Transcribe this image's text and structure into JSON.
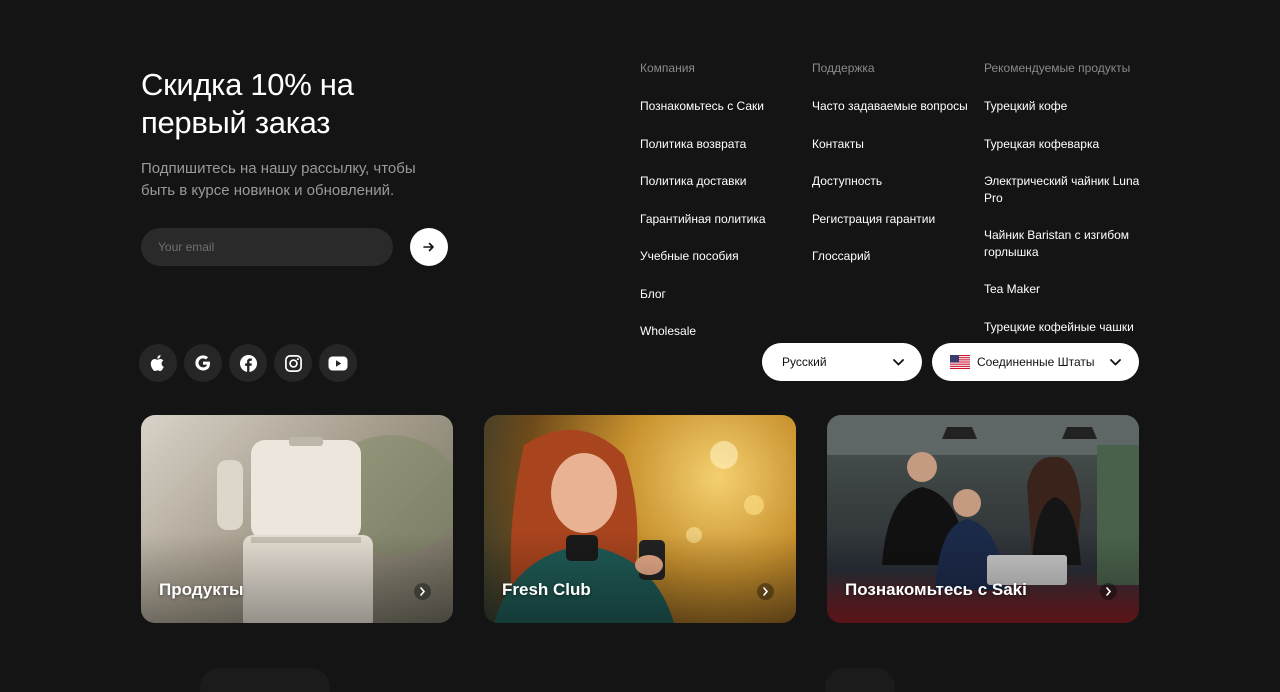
{
  "newsletter": {
    "title": "Скидка 10% на\nпервый заказ",
    "subtitle": "Подпишитесь на нашу рассылку, чтобы\nбыть в курсе новинок и обновлений.",
    "email_placeholder": "Your email",
    "submit_icon": "arrow-right-icon"
  },
  "social": [
    {
      "icon": "apple-icon"
    },
    {
      "icon": "google-icon"
    },
    {
      "icon": "facebook-icon"
    },
    {
      "icon": "instagram-icon"
    },
    {
      "icon": "youtube-icon"
    }
  ],
  "columns": [
    {
      "title": "Компания",
      "links": [
        "Познакомьтесь с Саки",
        "Политика возврата",
        "Политика доставки",
        "Гарантийная политика",
        "Учебные пособия",
        "Блог",
        "Wholesale"
      ]
    },
    {
      "title": "Поддержка",
      "links": [
        "Часто задаваемые вопросы",
        "Контакты",
        "Доступность",
        "Регистрация гарантии",
        "Глоссарий"
      ]
    },
    {
      "title": "Рекомендуемые продукты",
      "links": [
        "Турецкий кофе",
        "Турецкая кофеварка",
        "Электрический чайник Luna Pro",
        "Чайник Baristan с изгибом горлышка",
        "Tea Maker",
        "Турецкие кофейные чашки"
      ]
    }
  ],
  "selectors": {
    "language": "Русский",
    "country": "Соединенные Штаты",
    "country_flag": "us-flag-icon"
  },
  "cards": [
    {
      "label": "Продукты",
      "icon": "chevron-right-icon"
    },
    {
      "label": "Fresh Club",
      "icon": "chevron-right-icon"
    },
    {
      "label": "Познакомьтесь с Saki",
      "icon": "chevron-right-icon"
    }
  ],
  "colors": {
    "background": "#141414",
    "text": "#ffffff",
    "muted": "#8a8a8a",
    "input": "#2a2a2a"
  }
}
